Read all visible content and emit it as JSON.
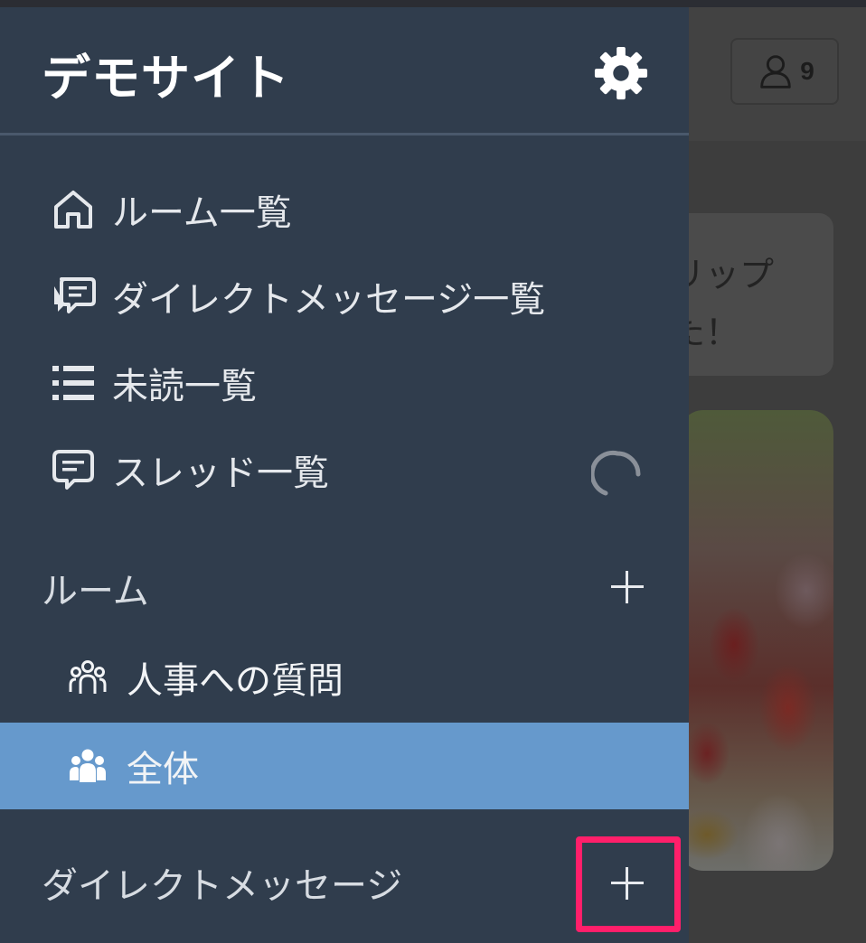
{
  "app": {
    "site_title": "デモサイト"
  },
  "header_right": {
    "member_count": "9"
  },
  "background_message": {
    "line1": "リップ",
    "line2": "た！"
  },
  "nav": {
    "rooms_list": "ルーム一覧",
    "dm_list": "ダイレクトメッセージ一覧",
    "unread_list": "未読一覧",
    "thread_list": "スレッド一覧"
  },
  "rooms_section": {
    "title": "ルーム",
    "items": [
      {
        "label": "人事への質問",
        "active": false
      },
      {
        "label": "全体",
        "active": true
      }
    ]
  },
  "dm_section": {
    "title": "ダイレクトメッセージ"
  },
  "colors": {
    "sidebar_bg": "#303d4d",
    "active_item": "#6699cc",
    "highlight_box": "#ff1f6a"
  },
  "icons": {
    "settings": "gear-icon",
    "rooms_list": "home-icon",
    "dm_list": "chat-bubbles-icon",
    "unread_list": "list-icon",
    "thread_list": "thread-bubble-icon",
    "room_group": "people-icon",
    "loading": "spinner-icon",
    "add": "plus-icon",
    "members": "user-icon"
  }
}
